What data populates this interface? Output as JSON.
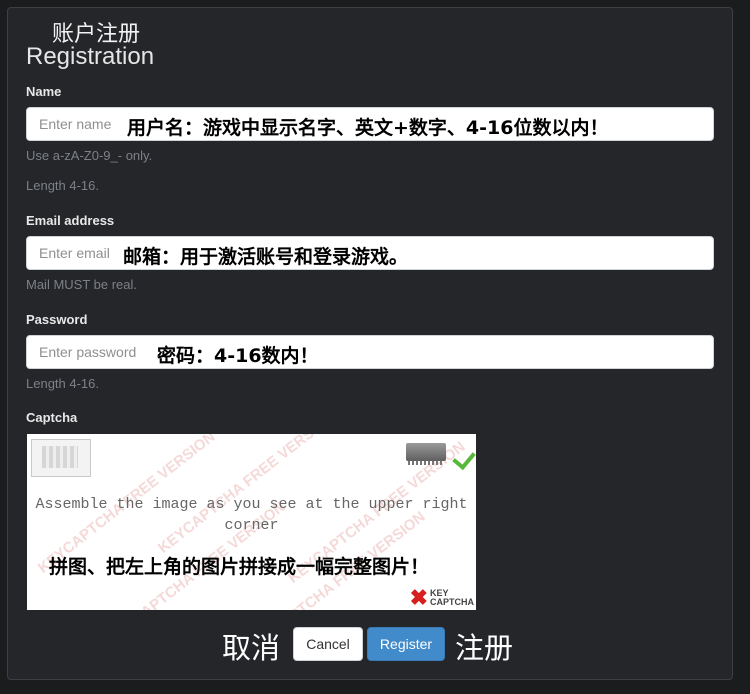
{
  "header": {
    "title_cn": "账户注册",
    "title_en": "Registration"
  },
  "name": {
    "label": "Name",
    "placeholder": "Enter name",
    "overlay": "用户名：游戏中显示名字、英文+数字、4-16位数以内！",
    "help1": "Use a-zA-Z0-9_- only.",
    "help2": "Length 4-16."
  },
  "email": {
    "label": "Email address",
    "placeholder": "Enter email",
    "overlay": "邮箱：用于激活账号和登录游戏。",
    "help": "Mail MUST be real."
  },
  "password": {
    "label": "Password",
    "placeholder": "Enter password",
    "overlay": "密码：4-16数内！",
    "help": "Length 4-16."
  },
  "captcha": {
    "label": "Captcha",
    "instruction": "Assemble the image as you see at the upper right corner",
    "overlay": "拼图、把左上角的图片拼接成一幅完整图片！",
    "watermark": "KEYCAPTCHA FREE VERSION",
    "logo_line1": "KEY",
    "logo_line2": "CAPTCHA",
    "icons": [
      "puzzle-slot-icon",
      "chip-icon",
      "checkmark-icon",
      "keycaptcha-logo-icon"
    ]
  },
  "actions": {
    "cancel_cn": "取消",
    "cancel_label": "Cancel",
    "register_label": "Register",
    "register_cn": "注册"
  },
  "colors": {
    "primary": "#428bca",
    "background": "#24262a",
    "check": "#58b83a"
  }
}
